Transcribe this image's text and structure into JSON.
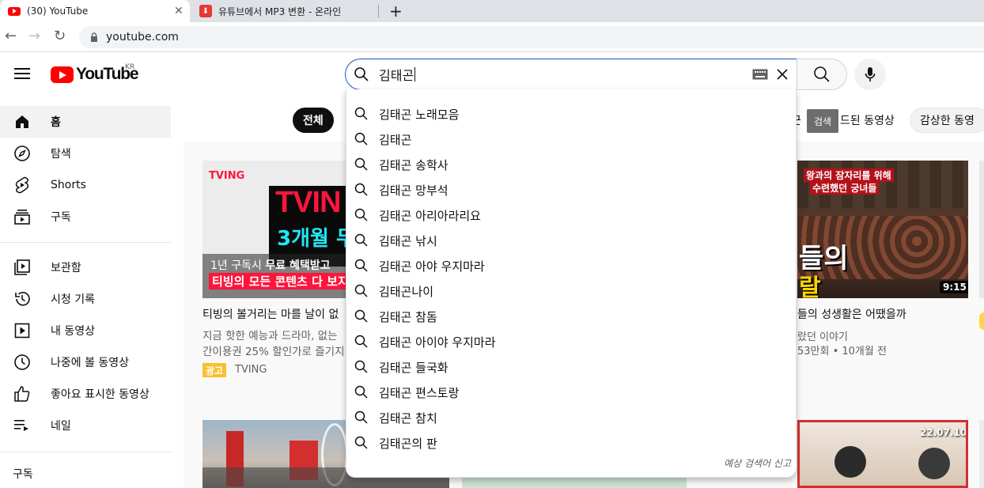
{
  "browser": {
    "tabs": [
      {
        "title": "(30) YouTube",
        "close": "✕"
      },
      {
        "title": "유튜브에서 MP3 변환 - 온라인"
      }
    ],
    "new_tab": "+",
    "url": "youtube.com"
  },
  "masthead": {
    "logo_text": "YouTube",
    "region": "KR",
    "search_value": "김태곤",
    "search_tooltip": "검색"
  },
  "suggestions": [
    "김태곤 노래모음",
    "김태곤",
    "김태곤 송학사",
    "김태곤 망부석",
    "김태곤 아리아라리요",
    "김태곤 낚시",
    "김태곤 아야 우지마라",
    "김태곤나이",
    "김태곤 참돔",
    "김태곤 아이야 우지마라",
    "김태곤 들국화",
    "김태곤 편스토랑",
    "김태곤 참치",
    "김태곤의 판"
  ],
  "suggest_report": "예상 검색어 신고",
  "sidebar": {
    "items": [
      {
        "label": "홈",
        "icon": "home-icon"
      },
      {
        "label": "탐색",
        "icon": "compass-icon"
      },
      {
        "label": "Shorts",
        "icon": "shorts-icon"
      },
      {
        "label": "구독",
        "icon": "subscriptions-icon"
      },
      {
        "label": "보관함",
        "icon": "library-icon"
      },
      {
        "label": "시청 기록",
        "icon": "history-icon"
      },
      {
        "label": "내 동영상",
        "icon": "my-videos-icon"
      },
      {
        "label": "나중에 볼 동영상",
        "icon": "watch-later-icon"
      },
      {
        "label": "좋아요 표시한 동영상",
        "icon": "like-icon"
      },
      {
        "label": "네일",
        "icon": "playlist-icon"
      }
    ],
    "section_title": "구독"
  },
  "chips": {
    "all": "전체",
    "partial": "근",
    "recent_upload": "드된 동영상",
    "watched": "감상한 동영"
  },
  "ad": {
    "brand_small": "TVING",
    "big_line1": "TVIN",
    "big_line2": "3개월 두",
    "text_line1_a": "1년 구독시 ",
    "text_line1_b": "무료 혜택받고",
    "text_line2": "티빙의 모든 콘텐츠 다 보지",
    "title": "티빙의 볼거리는 마를 날이 없",
    "desc1": "지금 핫한 예능과 드라마, 없는",
    "desc2": "간이용권 25% 할인가로 즐기지",
    "badge": "광고",
    "channel": "TVING"
  },
  "video2": {
    "thumb_top1": "왕과의 잠자리를 위해",
    "thumb_top2": "수련했던 궁녀들",
    "thumb_big1": "들의",
    "thumb_big2": "랄",
    "duration": "9:15",
    "title": "들의 성생활은 어땠을까",
    "channel_frag": "랐던 이야기",
    "stats": "53만회 • 10개월 전"
  },
  "video3": {
    "date": "22.07.10"
  }
}
